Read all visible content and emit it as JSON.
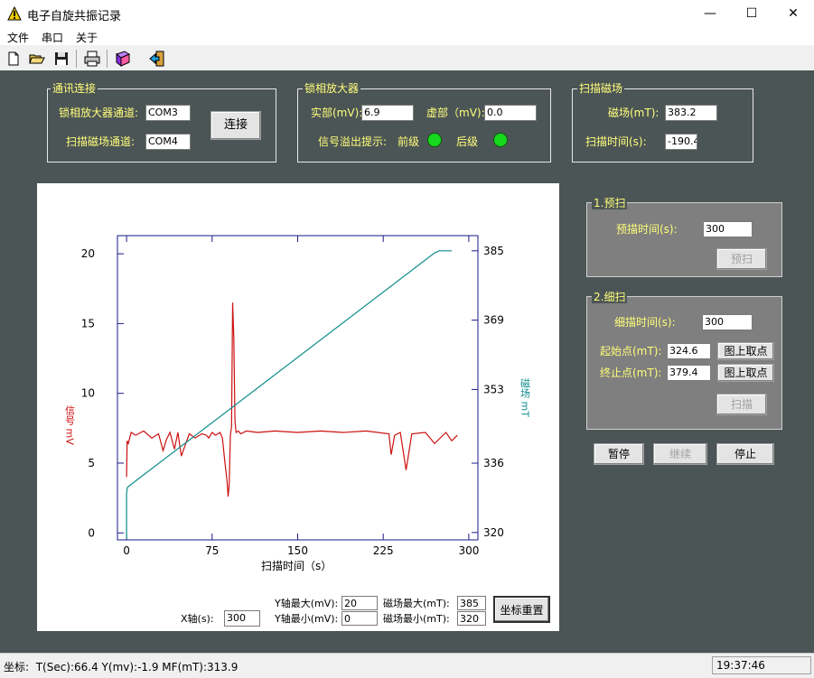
{
  "window": {
    "title": "电子自旋共振记录",
    "minimize": "—",
    "maximize": "☐",
    "close": "✕"
  },
  "menu": [
    "文件",
    "串口",
    "关于"
  ],
  "toolbar": [
    "new-file-icon",
    "open-folder-icon",
    "save-icon",
    "print-icon",
    "book-icon",
    "exit-icon"
  ],
  "comm": {
    "title": "通讯连接",
    "lockin_label": "锁相放大器通道:",
    "lockin_value": "COM3",
    "scan_label": "扫描磁场通道:",
    "scan_value": "COM4",
    "connect_button": "连接"
  },
  "amplifier": {
    "title": "锁相放大器",
    "real_label": "实部(mV):",
    "real_value": "6.9",
    "imag_label": "虚部（mV):",
    "imag_value": "0.0",
    "overflow_label": "信号溢出提示:",
    "front_label": "前级",
    "back_label": "后级",
    "led_color": "#18d81e"
  },
  "scanfield": {
    "title": "扫描磁场",
    "field_label": "磁场(mT):",
    "field_value": "383.2",
    "time_label": "扫描时间(s):",
    "time_value": "-190.4"
  },
  "prescan": {
    "title": "1.预扫",
    "time_label": "预描时间(s):",
    "time_value": "300",
    "button": "预扫"
  },
  "finescan": {
    "title": "2.细扫",
    "time_label": "细描时间(s):",
    "time_value": "300",
    "start_label": "起始点(mT):",
    "start_value": "324.6",
    "start_button": "图上取点",
    "end_label": "终止点(mT):",
    "end_value": "379.4",
    "end_button": "图上取点",
    "button": "扫描"
  },
  "controls": {
    "pause": "暂停",
    "resume": "继续",
    "stop": "停止"
  },
  "axis_controls": {
    "x_label": "X轴(s):",
    "x_value": "300",
    "ymax_label": "Y轴最大(mV):",
    "ymax_value": "20",
    "ymin_label": "Y轴最小(mV):",
    "ymin_value": "0",
    "bmax_label": "磁场最大(mT):",
    "bmax_value": "385",
    "bmin_label": "磁场最小(mT):",
    "bmin_value": "320",
    "reset_button": "坐标重置"
  },
  "status": {
    "label": "坐标:",
    "readout": "T(Sec):66.4   Y(mv):-1.9   MF(mT):313.9",
    "time": "19:37:46"
  },
  "chart_data": {
    "type": "line",
    "xlabel": "扫描时间（s）",
    "ylabel_left": "信号 mV",
    "ylabel_right": "磁场 mT",
    "x_ticks": [
      0,
      75,
      150,
      225,
      300
    ],
    "y_left_ticks": [
      0,
      5,
      10,
      15,
      20
    ],
    "y_right_ticks": [
      320,
      336,
      353,
      369,
      385
    ],
    "xlim": [
      -8,
      308
    ],
    "ylim_left": [
      -0.5,
      21.3
    ],
    "ylim_right": [
      318.3,
      388.5
    ],
    "series": [
      {
        "color": "#cc1010",
        "axis": "left",
        "x": [
          0,
          0.5,
          1.5,
          4,
          8,
          15,
          22,
          28,
          32,
          35,
          38,
          42,
          45,
          48,
          55,
          60,
          66,
          70,
          72,
          75,
          78,
          82,
          84,
          86,
          88,
          89,
          90,
          91,
          92,
          93,
          94,
          95,
          96,
          98,
          100,
          105,
          115,
          130,
          150,
          170,
          190,
          210,
          230,
          232,
          235,
          240,
          245,
          250,
          262,
          270,
          280,
          285,
          290
        ],
        "y": [
          4.0,
          6.6,
          6.4,
          7.2,
          7.0,
          7.3,
          6.8,
          7.1,
          5.9,
          6.7,
          7.2,
          6.0,
          7.2,
          5.5,
          7.1,
          6.8,
          7.1,
          7.0,
          6.8,
          7.2,
          7.0,
          7.2,
          6.8,
          5.2,
          3.8,
          2.6,
          3.5,
          7.0,
          7.6,
          16.5,
          14.0,
          8.0,
          7.2,
          7.3,
          7.1,
          7.3,
          7.2,
          7.3,
          7.2,
          7.3,
          7.2,
          7.3,
          7.1,
          5.6,
          7.0,
          7.2,
          4.5,
          7.1,
          7.2,
          6.4,
          7.2,
          6.6,
          7.0
        ]
      },
      {
        "color": "#0e8c8c",
        "axis": "right",
        "x": [
          0,
          0,
          0.5,
          1,
          270,
          274,
          285
        ],
        "y": [
          318.5,
          329.0,
          330.0,
          330.5,
          384.5,
          385.0,
          385.0
        ]
      }
    ]
  }
}
